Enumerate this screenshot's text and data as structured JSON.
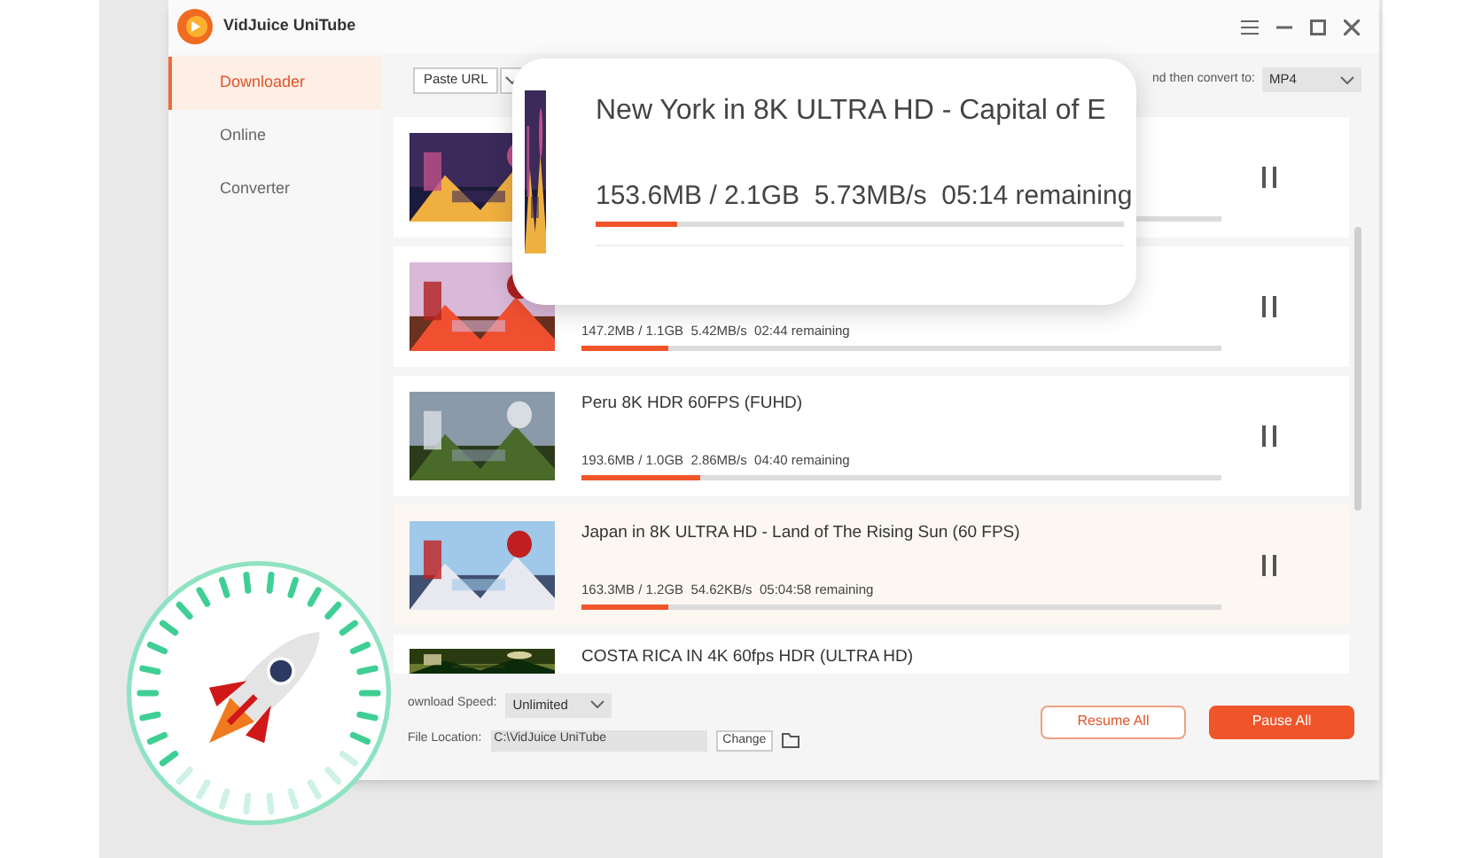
{
  "window": {
    "title": "VidJuice UniTube"
  },
  "sidebar": {
    "items": [
      {
        "label": "Downloader",
        "selected": true
      },
      {
        "label": "Online",
        "selected": false
      },
      {
        "label": "Converter",
        "selected": false
      }
    ]
  },
  "toolbar": {
    "paste_button": "Paste URL",
    "convert_label": "nd then convert to:",
    "format": "MP4"
  },
  "downloads": [
    {
      "kind": "covered",
      "selected": false
    },
    {
      "kind": "stats_only",
      "stats": "147.2MB / 1.1GB  5.42MB/s  02:44 remaining",
      "level": 0.135,
      "selected": false
    },
    {
      "kind": "full",
      "title": "Peru 8K HDR 60FPS (FUHD)",
      "stats": "193.6MB / 1.0GB  2.86MB/s  04:40 remaining",
      "level": 0.185,
      "selected": false
    },
    {
      "kind": "full",
      "title": "Japan in 8K ULTRA HD - Land of The Rising Sun (60 FPS)",
      "stats": "163.3MB / 1.2GB  54.62KB/s  05:04:58 remaining",
      "level": 0.135,
      "selected": true
    },
    {
      "kind": "title_only",
      "title": "COSTA RICA IN 4K 60fps HDR (ULTRA HD)",
      "selected": false
    }
  ],
  "footer": {
    "speed_label": "ownload Speed:",
    "speed": "Unlimited",
    "location_label": "File Location:",
    "location": "C:\\VidJuice UniTube",
    "change_button": "Change",
    "resume_button": "Resume All",
    "pause_button": "Pause All"
  },
  "popup": {
    "title": "New York in 8K ULTRA HD - Capital of E",
    "stats": "153.6MB / 2.1GB  5.73MB/s  05:14 remaining",
    "level": 0.155
  }
}
